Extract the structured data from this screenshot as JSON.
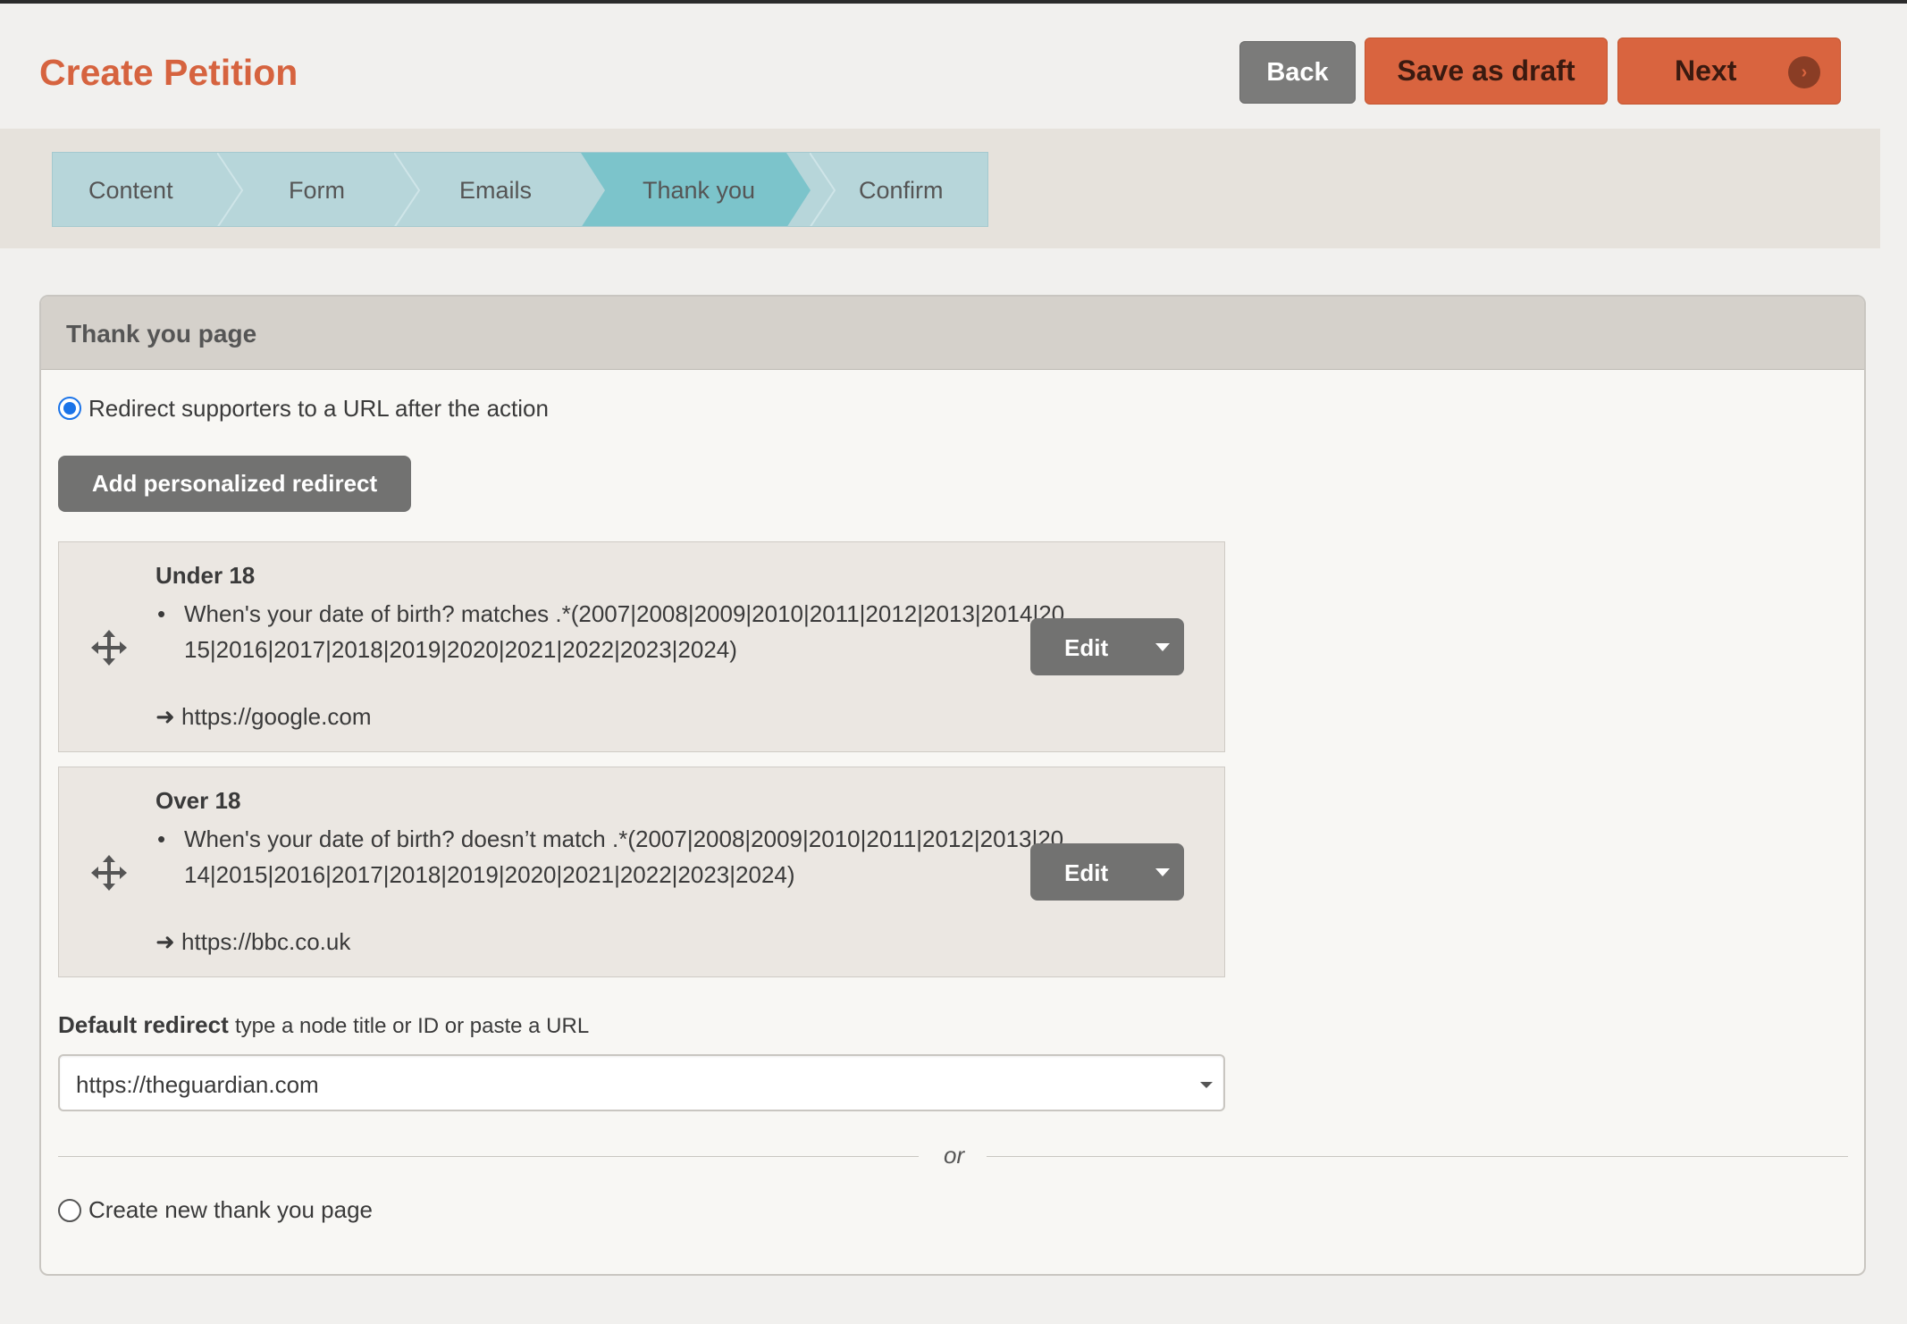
{
  "header": {
    "title": "Create Petition",
    "back_label": "Back",
    "draft_label": "Save as draft",
    "next_label": "Next"
  },
  "steps": [
    "Content",
    "Form",
    "Emails",
    "Thank you",
    "Confirm"
  ],
  "active_step": "Thank you",
  "panel": {
    "title": "Thank you page",
    "redirect_option": "Redirect supporters to a URL after the action",
    "add_button": "Add personalized redirect",
    "rules": [
      {
        "title": "Under 18",
        "condition": "When's your date of birth? matches .*(2007|2008|2009|2010|2011|2012|2013|2014|2015|2016|2017|2018|2019|2020|2021|2022|2023|2024)",
        "destination": "https://google.com",
        "edit_label": "Edit"
      },
      {
        "title": "Over 18",
        "condition": "When's your date of birth? doesn’t match .*(2007|2008|2009|2010|2011|2012|2013|2014|2015|2016|2017|2018|2019|2020|2021|2022|2023|2024)",
        "destination": "https://bbc.co.uk",
        "edit_label": "Edit"
      }
    ],
    "default_redirect_label": "Default redirect",
    "default_redirect_hint": "type a node title or ID or paste a URL",
    "default_redirect_value": "https://theguardian.com",
    "or_text": "or",
    "new_page_option": "Create new thank you page"
  },
  "colors": {
    "accent": "#d9643f",
    "step_active": "#7cc4cb",
    "step_inactive": "#b7d6da",
    "radio_selected": "#1a73e8"
  }
}
